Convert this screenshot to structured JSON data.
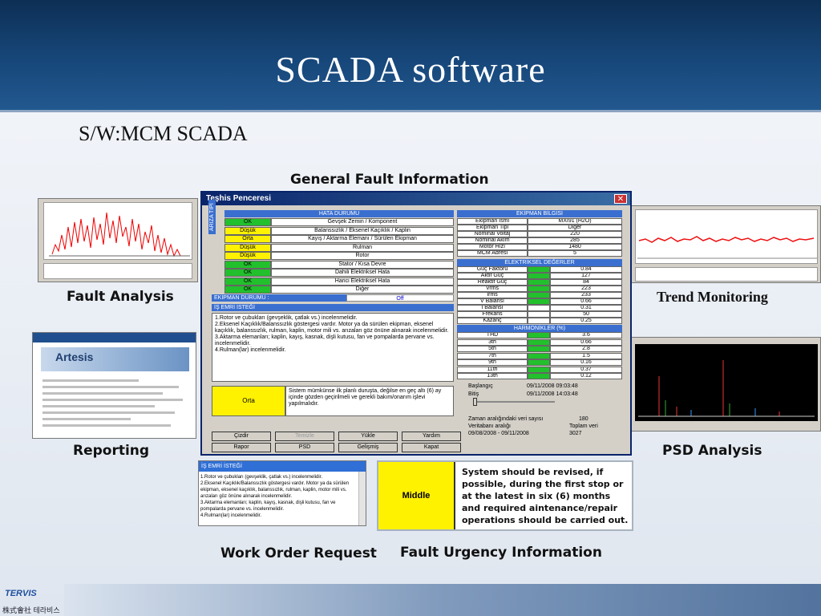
{
  "header": {
    "title": "SCADA software"
  },
  "subtitle": "S/W:MCM SCADA",
  "captions": {
    "general": "General Fault Information",
    "fault_analysis": "Fault Analysis",
    "trend": "Trend Monitoring",
    "reporting": "Reporting",
    "psd": "PSD Analysis",
    "work_order": "Work Order Request",
    "urgency": "Fault Urgency Information"
  },
  "colors": {
    "header_dark": "#0d2f55",
    "ok_green": "#22c02c",
    "warn_yellow": "#fff200",
    "dialog_blue": "#0a246a",
    "section_blue": "#3a6fd0"
  },
  "reporting": {
    "logo": "Artesis"
  },
  "dialog": {
    "title": "Teşhis Penceresi",
    "close_icon": "close-icon",
    "hata_header": "HATA DURUMU",
    "side_label": "ARIZA TİPİ",
    "faults": [
      {
        "level": "OK",
        "desc": "Gevşek Zemin / Komponent"
      },
      {
        "level": "Düşük",
        "desc": "Balanssızlık / Eksenel Kaçıklık / Kaplin"
      },
      {
        "level": "Orta",
        "desc": "Kayış / Aktarma Elemanı / Sürülen Ekipman"
      },
      {
        "level": "Düşük",
        "desc": "Rulman"
      },
      {
        "level": "Düşük",
        "desc": "Rotor"
      },
      {
        "level": "OK",
        "desc": "Stator / Kısa Devre"
      },
      {
        "level": "OK",
        "desc": "Dahili Elektriksel Hata"
      },
      {
        "level": "OK",
        "desc": "Harici Elektriksel Hata"
      },
      {
        "level": "OK",
        "desc": "Diğer"
      }
    ],
    "ekipman_durumu_label": "EKİPMAN DURUMU :",
    "ekipman_durumu_value": "Off",
    "is_emri_header": "İŞ EMRİ İSTEĞİ",
    "is_emri_text": "1.Rotor ve çubukları (gevşeklik, çatlak vs.) incelenmelidir.\n2.Eksenel Kaçıklık/Balanssızlık göstergesi vardır. Motor ya da sürülen ekipman, eksenel kaçıklık, balanssızlık, rulman, kaplin, motor mili vs. arızaları göz önüne alınarak incelenmelidir.\n3.Aktarma elemanları; kaplin, kayış, kasnak, dişli kutusu, fan ve pompalarda pervane vs. incelenmelidir.\n4.Rulman(lar) incelenmelidir.",
    "urgency_level": "Orta",
    "urgency_text": "Sistem mümkünse ilk planlı duruşta, değilse en geç altı (6) ay içinde gözden geçirilmeli ve gerekli bakım/onarım işlevi yapılmalıdır.",
    "ekipman_bilgisi_header": "EKİPMAN BİLGİSİ",
    "ekipman_bilgisi": [
      {
        "k": "Ekipman İsmi",
        "v": "MXI91 (H2O)"
      },
      {
        "k": "Ekipman Tipi",
        "v": "Diğer"
      },
      {
        "k": "Nominal Voltaj",
        "v": "220"
      },
      {
        "k": "Nominal Akım",
        "v": "285"
      },
      {
        "k": "Motor Hızı",
        "v": "1480"
      },
      {
        "k": "MCM Adresi",
        "v": "5"
      }
    ],
    "elektriksel_header": "ELEKTRİKSEL DEĞERLER",
    "elektriksel": [
      {
        "k": "Güç Faktörü",
        "v": "0.84",
        "flag": true
      },
      {
        "k": "Aktif Güç",
        "v": "127",
        "flag": true
      },
      {
        "k": "Reaktif Güç",
        "v": "84",
        "flag": true
      },
      {
        "k": "Vrms",
        "v": "223",
        "flag": true
      },
      {
        "k": "Irms",
        "v": "233",
        "flag": true
      },
      {
        "k": "V Balansı",
        "v": "0.66",
        "flag": true
      },
      {
        "k": "I Balansı",
        "v": "0.31",
        "flag": false
      },
      {
        "k": "Frekans",
        "v": "50",
        "flag": false
      },
      {
        "k": "Kazanç",
        "v": "0.25",
        "flag": false
      }
    ],
    "harmonik_header": "HARMONİKLER (%)",
    "harmonikler": [
      {
        "k": "THD",
        "v": "3.6"
      },
      {
        "k": "3th",
        "v": "0.66"
      },
      {
        "k": "5th",
        "v": "2.8"
      },
      {
        "k": "7th",
        "v": "1.5"
      },
      {
        "k": "9th",
        "v": "0.16"
      },
      {
        "k": "11th",
        "v": "0.37"
      },
      {
        "k": "13th",
        "v": "0.12"
      }
    ],
    "baslangic_label": "Başlangıç",
    "baslangic_value": "09/11/2008 09:03:48",
    "bitis_label": "Bitiş",
    "bitis_value": "09/11/2008 14:03:48",
    "zaman_label": "Zaman aralığındaki veri sayısı",
    "zaman_value": "180",
    "veritabani_label": "Veritabanı aralığı",
    "veritabani_value": "09/08/2008 - 09/11/2008",
    "toplam_label": "Toplam veri",
    "toplam_value": "3027",
    "buttons": [
      "Çizdir",
      "Temizle",
      "Yükle",
      "Yardım",
      "Rapor",
      "PSD",
      "Gelişmiş",
      "Kapat"
    ]
  },
  "work_order": {
    "header": "İŞ EMRİ İSTEĞİ",
    "text": "1.Rotor ve çubukları (gevşeklik, çatlak vs.) incelenmelidir.\n2.Eksenel Kaçıklık/Balanssızlık göstergesi vardır. Motor ya da sürülen ekipman, eksenel kaçıklık, balanssızlık, rulman, kaplin, motor mili vs. arızaları göz önüne alınarak incelenmelidir.\n3.Aktarma elemanları; kaplin, kayış, kasnak, dişli kutusu, fan ve pompalarda pervane vs. incelenmelidir.\n4.Rulman(lar) incelenmelidir."
  },
  "urgency": {
    "level": "Middle",
    "message": "System should be revised, if possible, during the first stop or at the latest in six (6) months and required aintenance/repair operations should be carried out."
  },
  "footer": {
    "logo": "TERVIS",
    "company": "株式會社 테라비스"
  }
}
